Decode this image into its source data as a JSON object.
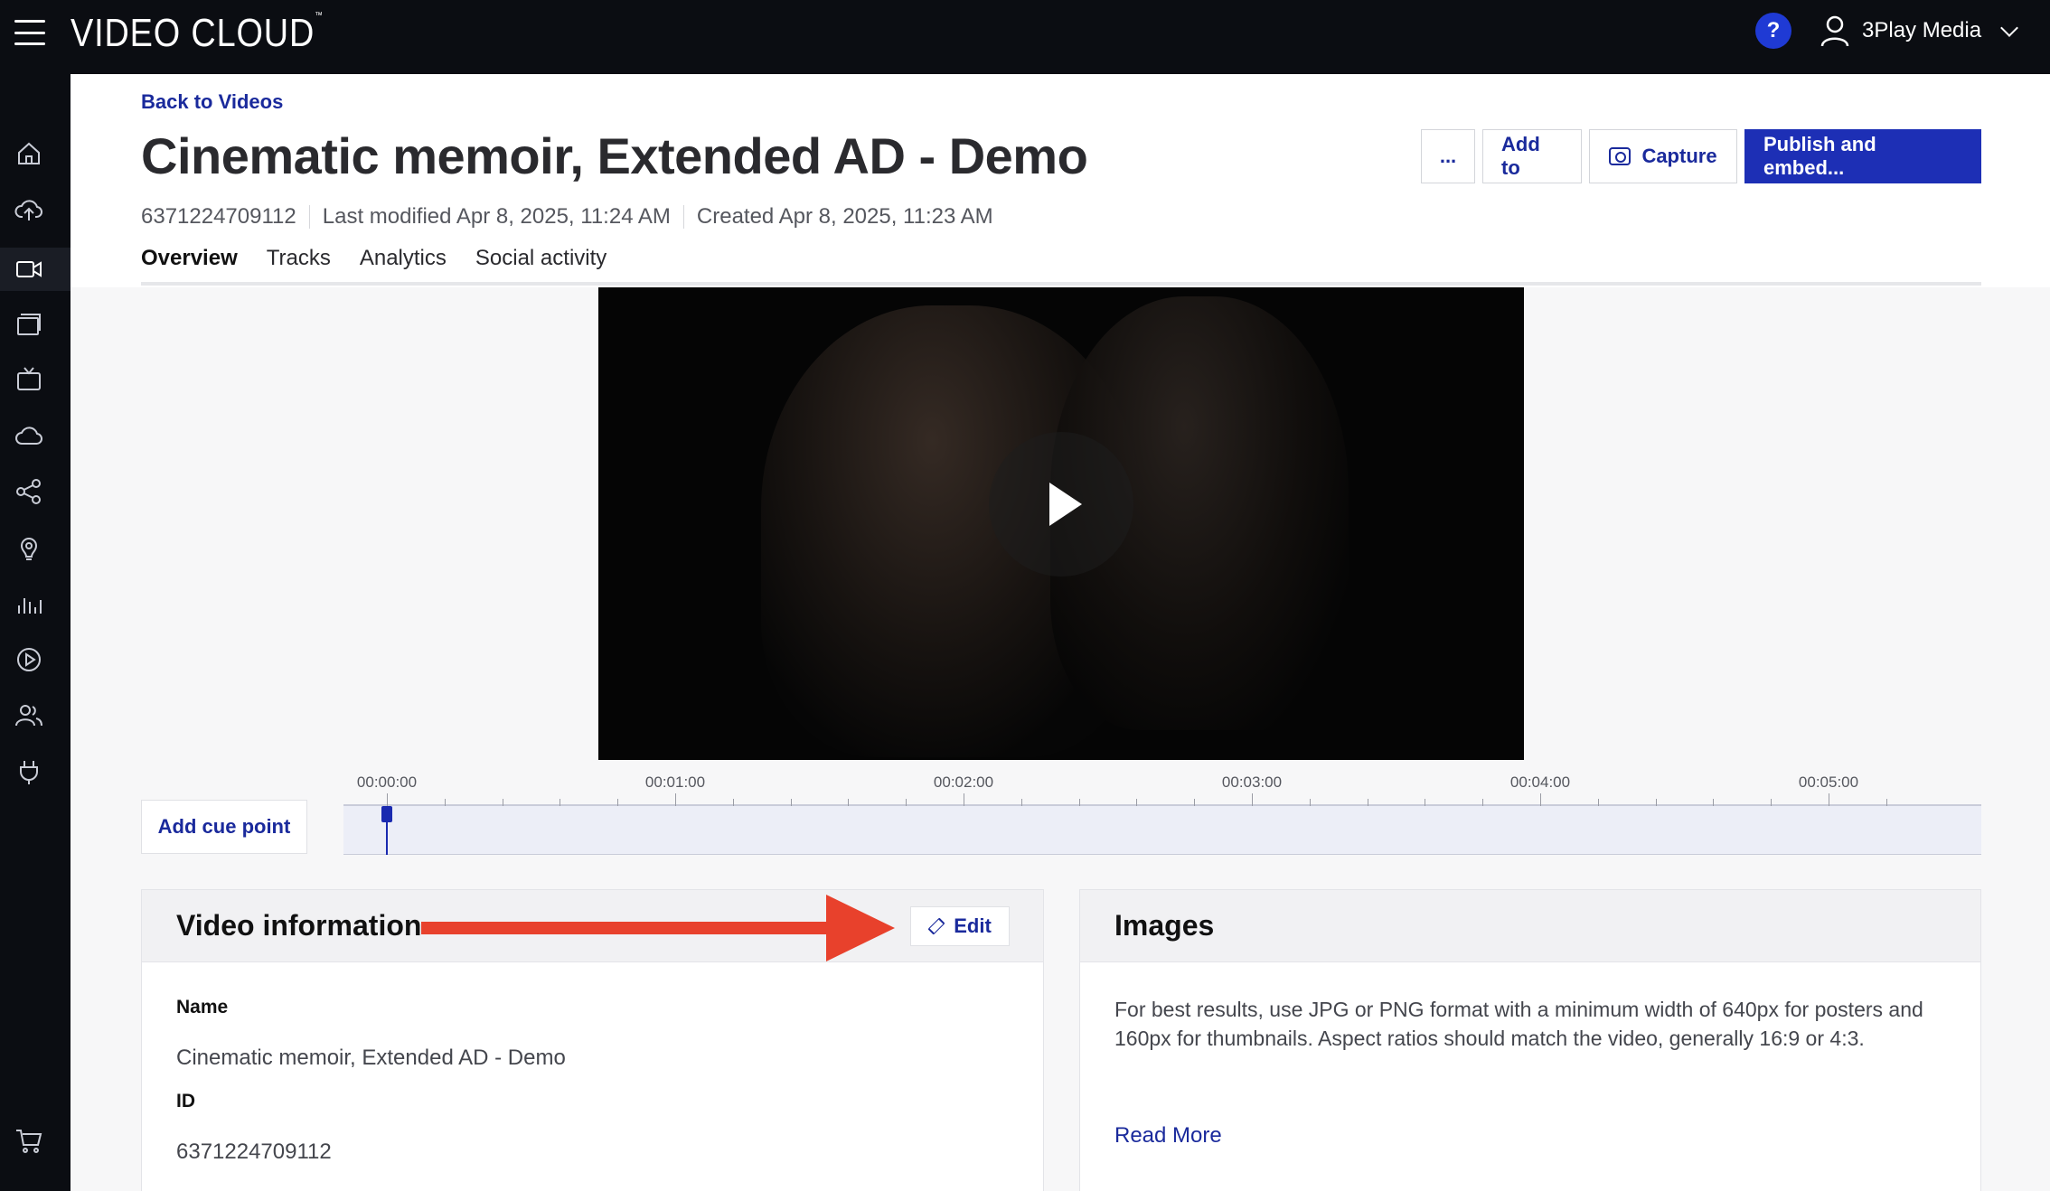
{
  "app": {
    "brand": "VIDEO CLOUD",
    "brand_mark": "™",
    "help_label": "?",
    "user_name": "3Play Media"
  },
  "sidebar": {
    "items": [
      {
        "icon": "home-icon"
      },
      {
        "icon": "upload-icon"
      },
      {
        "icon": "video-camera-icon",
        "active": true
      },
      {
        "icon": "playlist-icon"
      },
      {
        "icon": "tv-icon"
      },
      {
        "icon": "cloud-icon"
      },
      {
        "icon": "share-icon"
      },
      {
        "icon": "audience-icon"
      },
      {
        "icon": "analytics-icon"
      },
      {
        "icon": "play-circle-icon"
      },
      {
        "icon": "users-icon"
      },
      {
        "icon": "plugin-icon"
      },
      {
        "icon": "cart-icon"
      }
    ]
  },
  "header": {
    "back_link": "Back to Videos",
    "title": "Cinematic memoir, Extended AD - Demo",
    "video_id": "6371224709112",
    "last_modified": "Last modified Apr 8, 2025, 11:24 AM",
    "created": "Created Apr 8, 2025, 11:23 AM",
    "actions": {
      "more": "...",
      "add_to": "Add to",
      "capture": "Capture",
      "publish": "Publish and embed..."
    },
    "tabs": [
      {
        "label": "Overview",
        "active": true
      },
      {
        "label": "Tracks"
      },
      {
        "label": "Analytics"
      },
      {
        "label": "Social activity"
      }
    ]
  },
  "player": {
    "play_icon": "play-icon"
  },
  "timeline": {
    "add_cue_point": "Add cue point",
    "ticks": [
      "00:00:00",
      "00:01:00",
      "00:02:00",
      "00:03:00",
      "00:04:00",
      "00:05:00"
    ],
    "playhead_position": "00:00:00"
  },
  "video_info": {
    "heading": "Video information",
    "edit_label": "Edit",
    "name_label": "Name",
    "name_value": "Cinematic memoir, Extended AD - Demo",
    "id_label": "ID",
    "id_value": "6371224709112"
  },
  "images": {
    "heading": "Images",
    "description": "For best results, use JPG or PNG format with a minimum width of 640px for posters and 160px for thumbnails. Aspect ratios should match the video, generally 16:9 or 4:3.",
    "read_more": "Read More"
  },
  "colors": {
    "accent": "#1d2fb5",
    "topbar": "#0b0d12",
    "annotation_arrow": "#e8412c"
  }
}
